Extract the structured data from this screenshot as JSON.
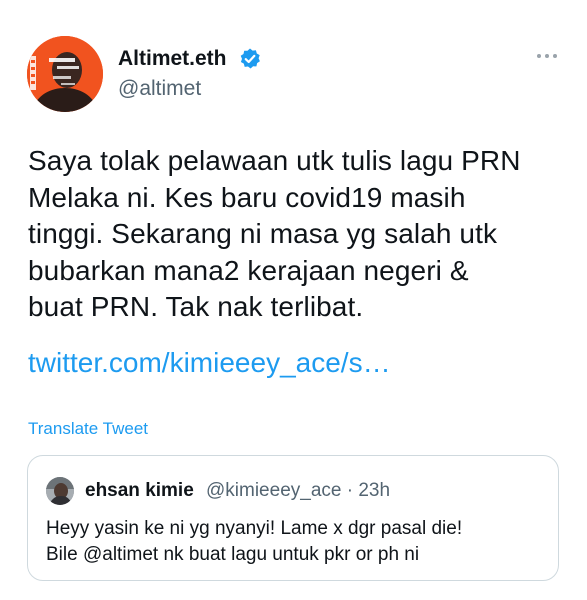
{
  "tweet": {
    "author": {
      "display_name": "Altimet.eth",
      "handle": "@altimet",
      "verified": true,
      "avatar_icon": "profile-photo"
    },
    "more_icon": "ellipsis-icon",
    "text": "Saya tolak pelawaan utk tulis lagu PRN\nMelaka ni. Kes baru covid19 masih\ntinggi. Sekarang ni masa yg salah utk\nbubarkan mana2 kerajaan negeri &\nbuat PRN. Tak nak terlibat.",
    "link_text": "twitter.com/kimieeey_ace/s…",
    "translate_label": "Translate Tweet"
  },
  "quoted_tweet": {
    "display_name": "ehsan kimie",
    "meta": "@kimieeey_ace · 23h",
    "text": "Heyy  yasin ke ni yg nyanyi! Lame x dgr pasal die!\nBile @altimet  nk buat lagu untuk pkr or ph ni"
  },
  "colors": {
    "accent": "#1d9bf0",
    "secondary_text": "#536471",
    "avatar_background": "#f1531f",
    "border": "#cfd9de"
  }
}
